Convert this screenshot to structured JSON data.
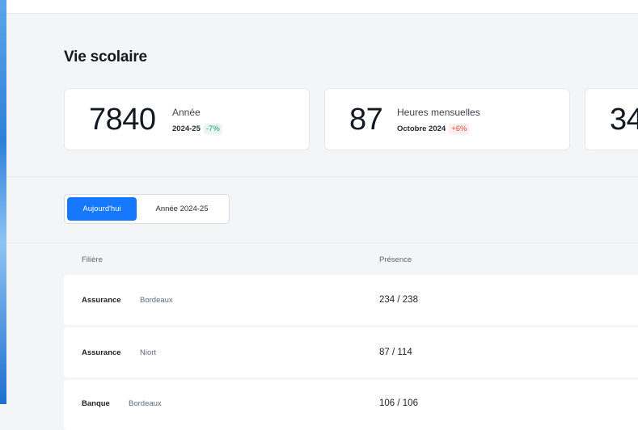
{
  "page": {
    "title": "Vie scolaire"
  },
  "stats": [
    {
      "value": "7840",
      "label": "Année",
      "period": "2024-25",
      "delta": "-7%",
      "delta_color": "#14a37a"
    },
    {
      "value": "87",
      "label": "Heures mensuelles",
      "period": "Octobre 2024",
      "delta": "+6%",
      "delta_color": "#e24b3b"
    },
    {
      "value": "34"
    }
  ],
  "toggle": {
    "options": [
      "Aujourd'hui",
      "Année 2024-25"
    ],
    "active": "Aujourd'hui",
    "accent": "#1677ff"
  },
  "table": {
    "headers": [
      "Filière",
      "Présence"
    ],
    "rows": [
      {
        "filiere": "Assurance",
        "ville": "Bordeaux",
        "presence": "234 / 238"
      },
      {
        "filiere": "Assurance",
        "ville": "Niort",
        "presence": "87 / 114"
      },
      {
        "filiere": "Banque",
        "ville": "Bordeaux",
        "presence": "106 / 106"
      }
    ]
  }
}
